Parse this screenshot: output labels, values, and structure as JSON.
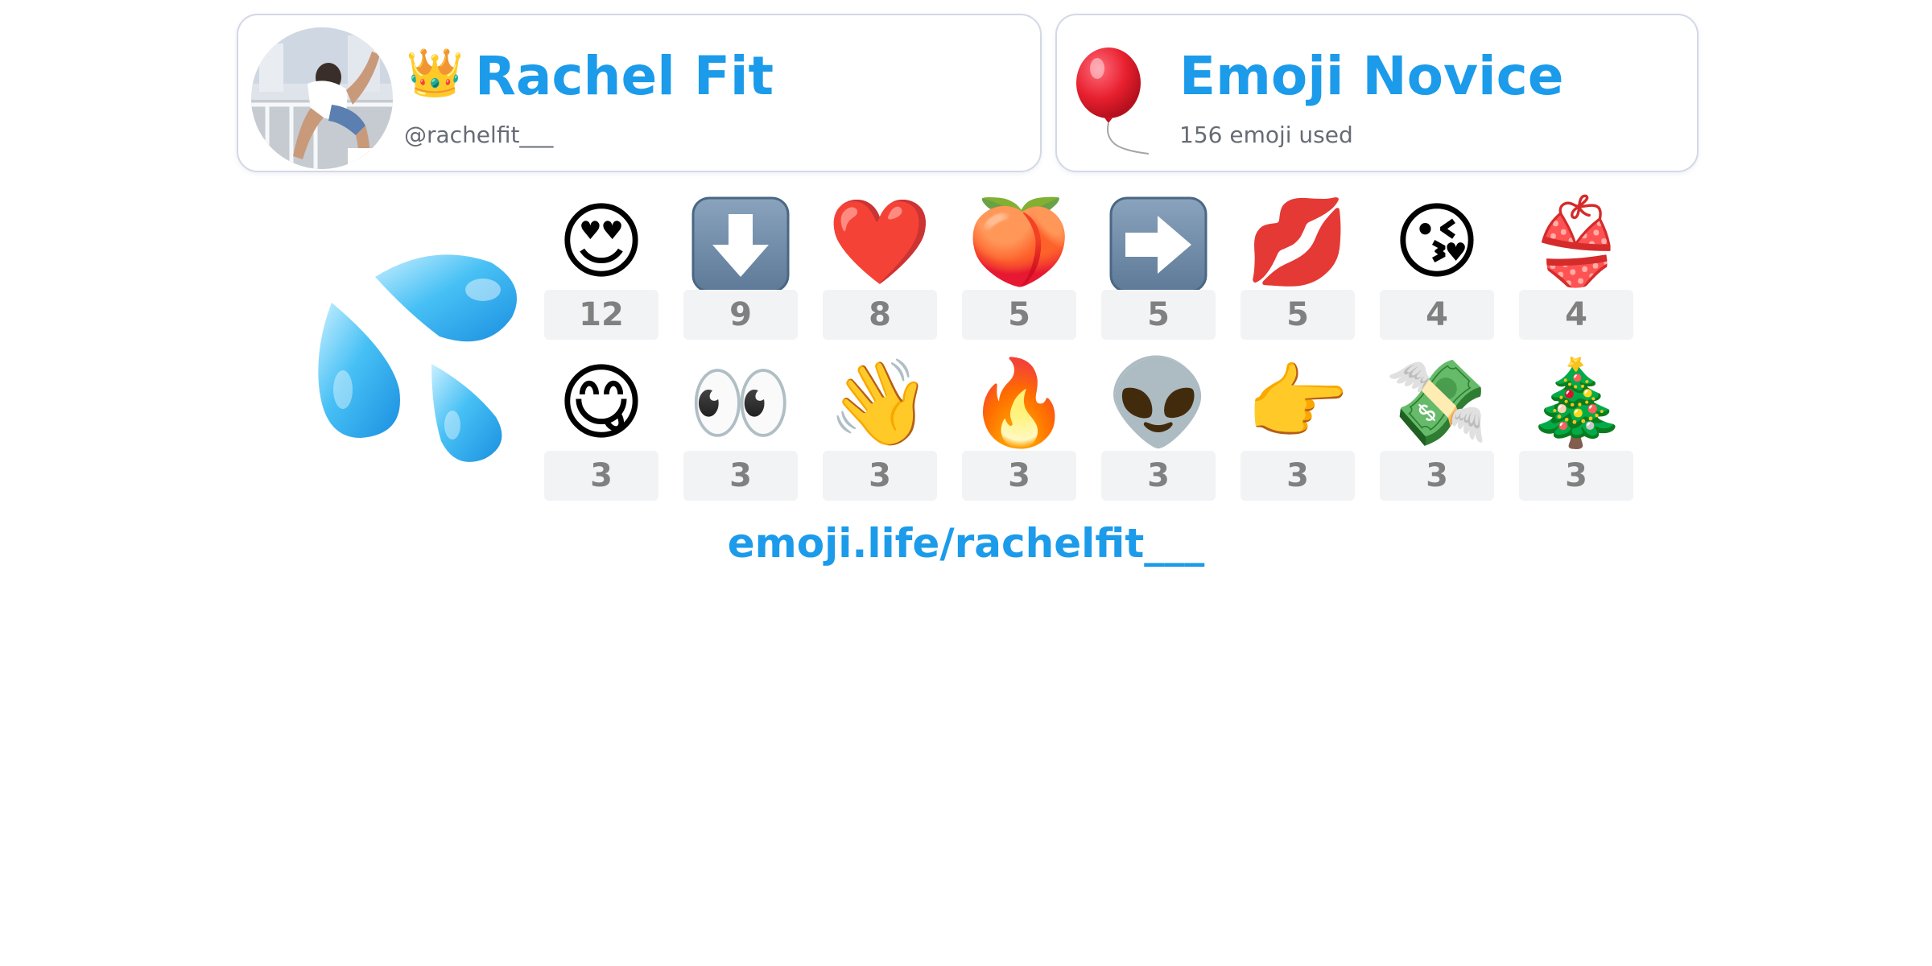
{
  "profile": {
    "name": "Rachel Fit",
    "handle": "@rachelfit___",
    "badge_emoji": "👑",
    "avatar_icon": "profile-photo"
  },
  "rank": {
    "title": "Emoji Novice",
    "subtitle": "156 emoji used",
    "icon_emoji": "🎈"
  },
  "hero_emoji": "💦",
  "top_emoji": [
    {
      "emoji": "😍",
      "count": "12"
    },
    {
      "emoji": "⬇️",
      "count": "9"
    },
    {
      "emoji": "❤️",
      "count": "8"
    },
    {
      "emoji": "🍑",
      "count": "5"
    },
    {
      "emoji": "➡️",
      "count": "5"
    },
    {
      "emoji": "💋",
      "count": "5"
    },
    {
      "emoji": "😘",
      "count": "4"
    },
    {
      "emoji": "👙",
      "count": "4"
    },
    {
      "emoji": "😋",
      "count": "3"
    },
    {
      "emoji": "👀",
      "count": "3"
    },
    {
      "emoji": "👋",
      "count": "3"
    },
    {
      "emoji": "🔥",
      "count": "3"
    },
    {
      "emoji": "👽",
      "count": "3"
    },
    {
      "emoji": "👉",
      "count": "3"
    },
    {
      "emoji": "💸",
      "count": "3"
    },
    {
      "emoji": "🎄",
      "count": "3"
    }
  ],
  "footer": {
    "link": "emoji.life/rachelfit___"
  },
  "colors": {
    "accent": "#1b9bea",
    "muted_text": "#666b75",
    "count_text": "#808080",
    "count_bg": "#f2f3f5",
    "card_border": "#d4d8e6"
  }
}
